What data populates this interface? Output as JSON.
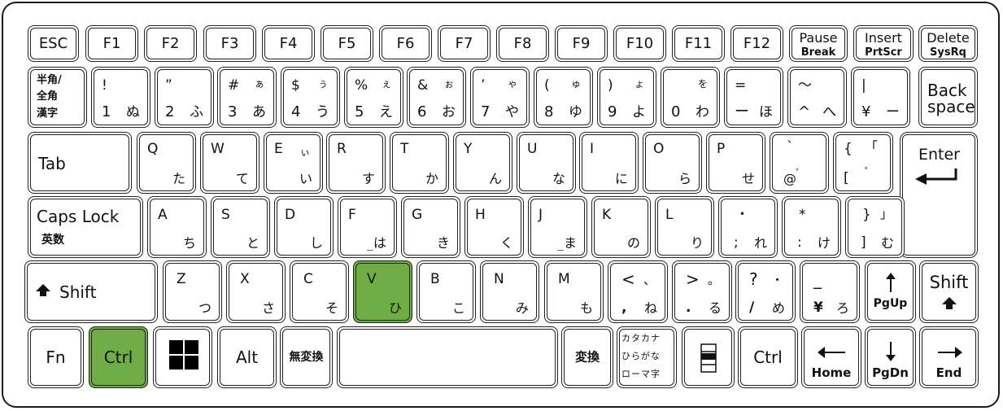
{
  "keyboard": {
    "highlight_color": "#70ad47",
    "highlighted_keys": [
      "Ctrl",
      "V"
    ],
    "row1": {
      "esc": "ESC",
      "f1": "F1",
      "f2": "F2",
      "f3": "F3",
      "f4": "F4",
      "f5": "F5",
      "f6": "F6",
      "f7": "F7",
      "f8": "F8",
      "f9": "F9",
      "f10": "F10",
      "f11": "F11",
      "f12": "F12",
      "pause": {
        "top": "Pause",
        "bottom": "Break"
      },
      "insert": {
        "top": "Insert",
        "bottom": "PrtScr"
      },
      "delete": {
        "top": "Delete",
        "bottom": "SysRq"
      }
    },
    "row2": {
      "hankaku": [
        "半角/",
        "全角",
        "漢字"
      ],
      "keys": [
        {
          "shift": "!",
          "main": "1",
          "kana": "ぬ",
          "kana_shift": ""
        },
        {
          "shift": "”",
          "main": "2",
          "kana": "ふ",
          "kana_shift": ""
        },
        {
          "shift": "#",
          "main": "3",
          "kana": "あ",
          "kana_shift": "ぁ"
        },
        {
          "shift": "$",
          "main": "4",
          "kana": "う",
          "kana_shift": "ぅ"
        },
        {
          "shift": "%",
          "main": "5",
          "kana": "え",
          "kana_shift": "ぇ"
        },
        {
          "shift": "&",
          "main": "6",
          "kana": "お",
          "kana_shift": "ぉ"
        },
        {
          "shift": "’",
          "main": "7",
          "kana": "や",
          "kana_shift": "ゃ"
        },
        {
          "shift": "(",
          "main": "8",
          "kana": "ゆ",
          "kana_shift": "ゅ"
        },
        {
          "shift": ")",
          "main": "9",
          "kana": "よ",
          "kana_shift": "ょ"
        },
        {
          "shift": "",
          "main": "0",
          "kana": "わ",
          "kana_shift": "を"
        },
        {
          "shift": "=",
          "main": "ー",
          "kana": "ほ",
          "kana_shift": ""
        },
        {
          "shift": "～",
          "main": "^",
          "kana": "へ",
          "kana_shift": ""
        },
        {
          "shift": "|",
          "main": "¥",
          "kana": "ー",
          "kana_shift": ""
        }
      ],
      "backspace": [
        "Back",
        "space"
      ]
    },
    "row3": {
      "tab": "Tab",
      "keys": [
        {
          "main": "Q",
          "kana": "た",
          "kana_shift": ""
        },
        {
          "main": "W",
          "kana": "て",
          "kana_shift": ""
        },
        {
          "main": "E",
          "kana": "い",
          "kana_shift": "ぃ"
        },
        {
          "main": "R",
          "kana": "す",
          "kana_shift": ""
        },
        {
          "main": "T",
          "kana": "か",
          "kana_shift": ""
        },
        {
          "main": "Y",
          "kana": "ん",
          "kana_shift": ""
        },
        {
          "main": "U",
          "kana": "な",
          "kana_shift": ""
        },
        {
          "main": "I",
          "kana": "に",
          "kana_shift": ""
        },
        {
          "main": "O",
          "kana": "ら",
          "kana_shift": ""
        },
        {
          "main": "P",
          "kana": "せ",
          "kana_shift": ""
        }
      ],
      "at": {
        "shift": "`",
        "main": "@",
        "kana": "゛"
      },
      "bracket": {
        "shift": "{",
        "main": "[",
        "kana_shift": "「",
        "kana": "゜"
      },
      "enter": "Enter"
    },
    "row4": {
      "caps": {
        "main": "Caps Lock",
        "sub": "英数"
      },
      "keys": [
        {
          "main": "A",
          "kana": "ち"
        },
        {
          "main": "S",
          "kana": "と"
        },
        {
          "main": "D",
          "kana": "し"
        },
        {
          "main": "F",
          "kana": "_は"
        },
        {
          "main": "G",
          "kana": "き"
        },
        {
          "main": "H",
          "kana": "く"
        },
        {
          "main": "J",
          "kana": "_ま"
        },
        {
          "main": "K",
          "kana": "の"
        },
        {
          "main": "L",
          "kana": "り"
        }
      ],
      "semicolon": {
        "shift": "・",
        "main": ";",
        "kana": "れ"
      },
      "colon": {
        "shift": "*",
        "main": ":",
        "kana": "け"
      },
      "rbracket": {
        "shift": "}",
        "main": "]",
        "kana_shift": "」",
        "kana": "む"
      }
    },
    "row5": {
      "lshift": "Shift",
      "keys": [
        {
          "main": "Z",
          "kana": "つ"
        },
        {
          "main": "X",
          "kana": "さ"
        },
        {
          "main": "C",
          "kana": "そ"
        },
        {
          "main": "V",
          "kana": "ひ"
        },
        {
          "main": "B",
          "kana": "こ"
        },
        {
          "main": "N",
          "kana": "み"
        },
        {
          "main": "M",
          "kana": "も"
        }
      ],
      "comma": {
        "shift": "<",
        "main": ",",
        "kana_shift": "、",
        "kana": "ね"
      },
      "period": {
        "shift": ">",
        "main": ".",
        "kana_shift": "。",
        "kana": "る"
      },
      "slash": {
        "shift": "?",
        "main": "/",
        "kana_shift": "・",
        "kana": "め"
      },
      "backslash": {
        "shift": "_",
        "main": "¥",
        "kana": "ろ"
      },
      "pgup": "PgUp",
      "rshift": "Shift"
    },
    "row6": {
      "fn": "Fn",
      "lctrl": "Ctrl",
      "win_icon": "windows-logo",
      "alt": "Alt",
      "muhenkan": "無変換",
      "space": "",
      "henkan": "変換",
      "kana": [
        "カタカナ",
        "ひらがな",
        "ローマ字"
      ],
      "menu_icon": "application-menu",
      "rctrl": "Ctrl",
      "home": "Home",
      "pgdn": "PgDn",
      "end": "End"
    }
  }
}
